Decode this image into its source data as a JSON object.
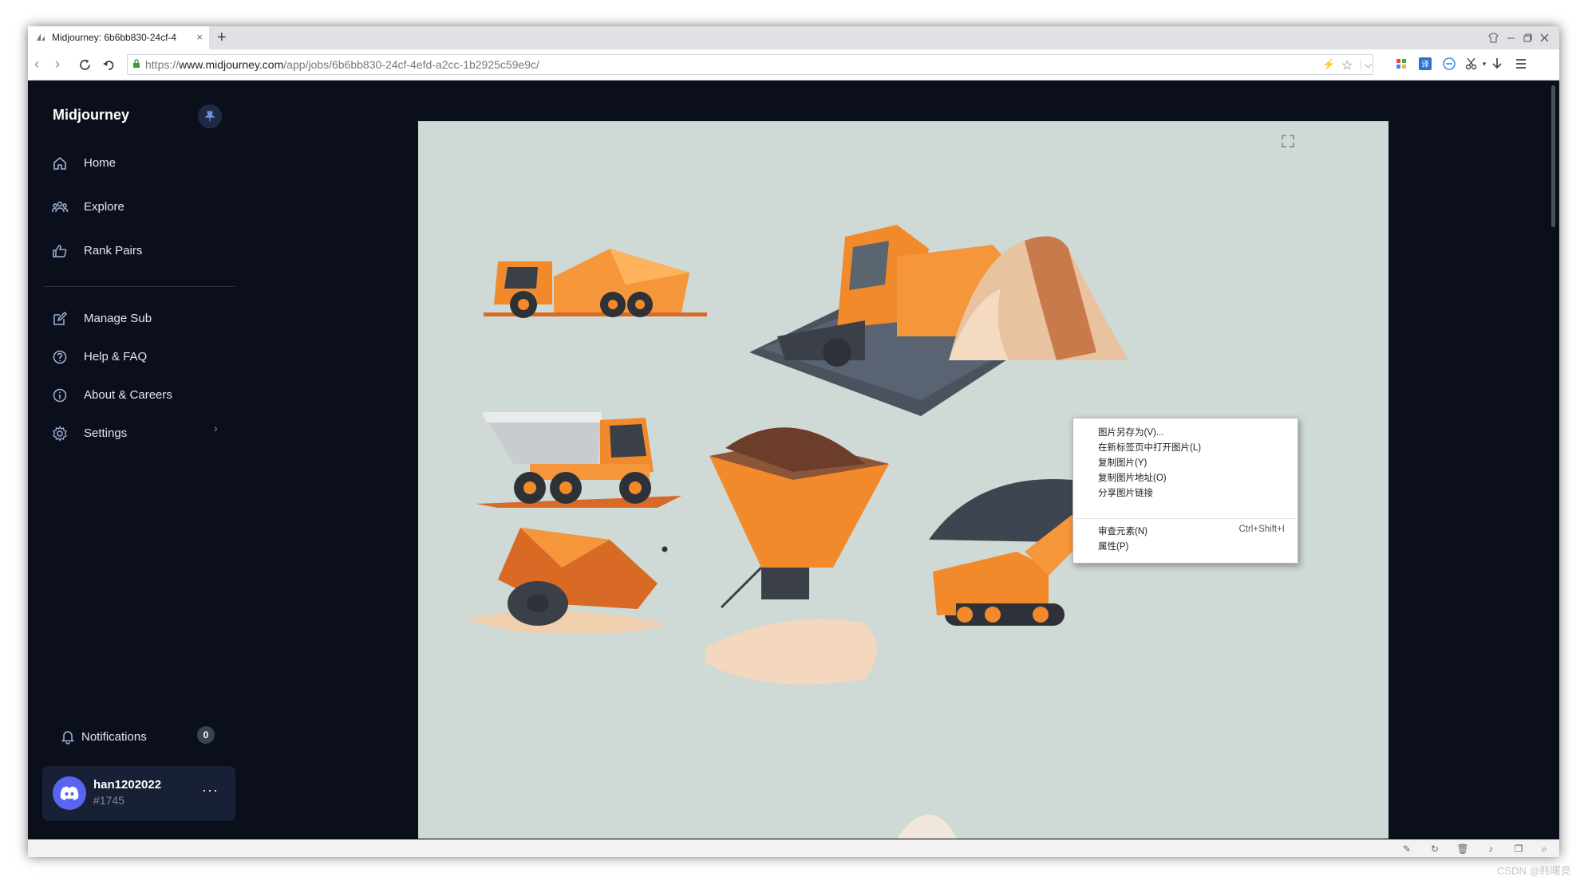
{
  "browser": {
    "tab_title": "Midjourney: 6b6bb830-24cf-4",
    "tab_close": "×",
    "new_tab": "+",
    "url_protocol": "https://",
    "url_host": "www.midjourney.com",
    "url_path": "/app/jobs/6b6bb830-24cf-4efd-a2cc-1b2925c59e9c/"
  },
  "sidebar": {
    "brand": "Midjourney",
    "primary_nav": [
      {
        "label": "Home",
        "icon": "home-icon"
      },
      {
        "label": "Explore",
        "icon": "people-icon"
      },
      {
        "label": "Rank Pairs",
        "icon": "thumbs-up-icon"
      }
    ],
    "secondary_nav": [
      {
        "label": "Manage Sub",
        "icon": "edit-icon"
      },
      {
        "label": "Help & FAQ",
        "icon": "help-icon"
      },
      {
        "label": "About & Careers",
        "icon": "info-icon"
      },
      {
        "label": "Settings",
        "icon": "gear-icon"
      }
    ],
    "notifications": {
      "label": "Notifications",
      "count": "0"
    },
    "user": {
      "name": "han1202022",
      "discriminator": "#1745",
      "more": "···"
    }
  },
  "context_menu": {
    "items": [
      {
        "label": "图片另存为(V)..."
      },
      {
        "label": "在新标签页中打开图片(L)"
      },
      {
        "label": "复制图片(Y)"
      },
      {
        "label": "复制图片地址(O)"
      },
      {
        "label": "分享图片链接"
      },
      {
        "label": "审查元素(N)",
        "shortcut": "Ctrl+Shift+I"
      },
      {
        "label": "属性(P)"
      }
    ]
  },
  "watermark": "CSDN @韩曙亮",
  "colors": {
    "app_bg": "#0b0f1c",
    "image_bg": "#cfd9d5",
    "accent_orange": "#f28a2c",
    "discord_blue": "#5865f2"
  }
}
